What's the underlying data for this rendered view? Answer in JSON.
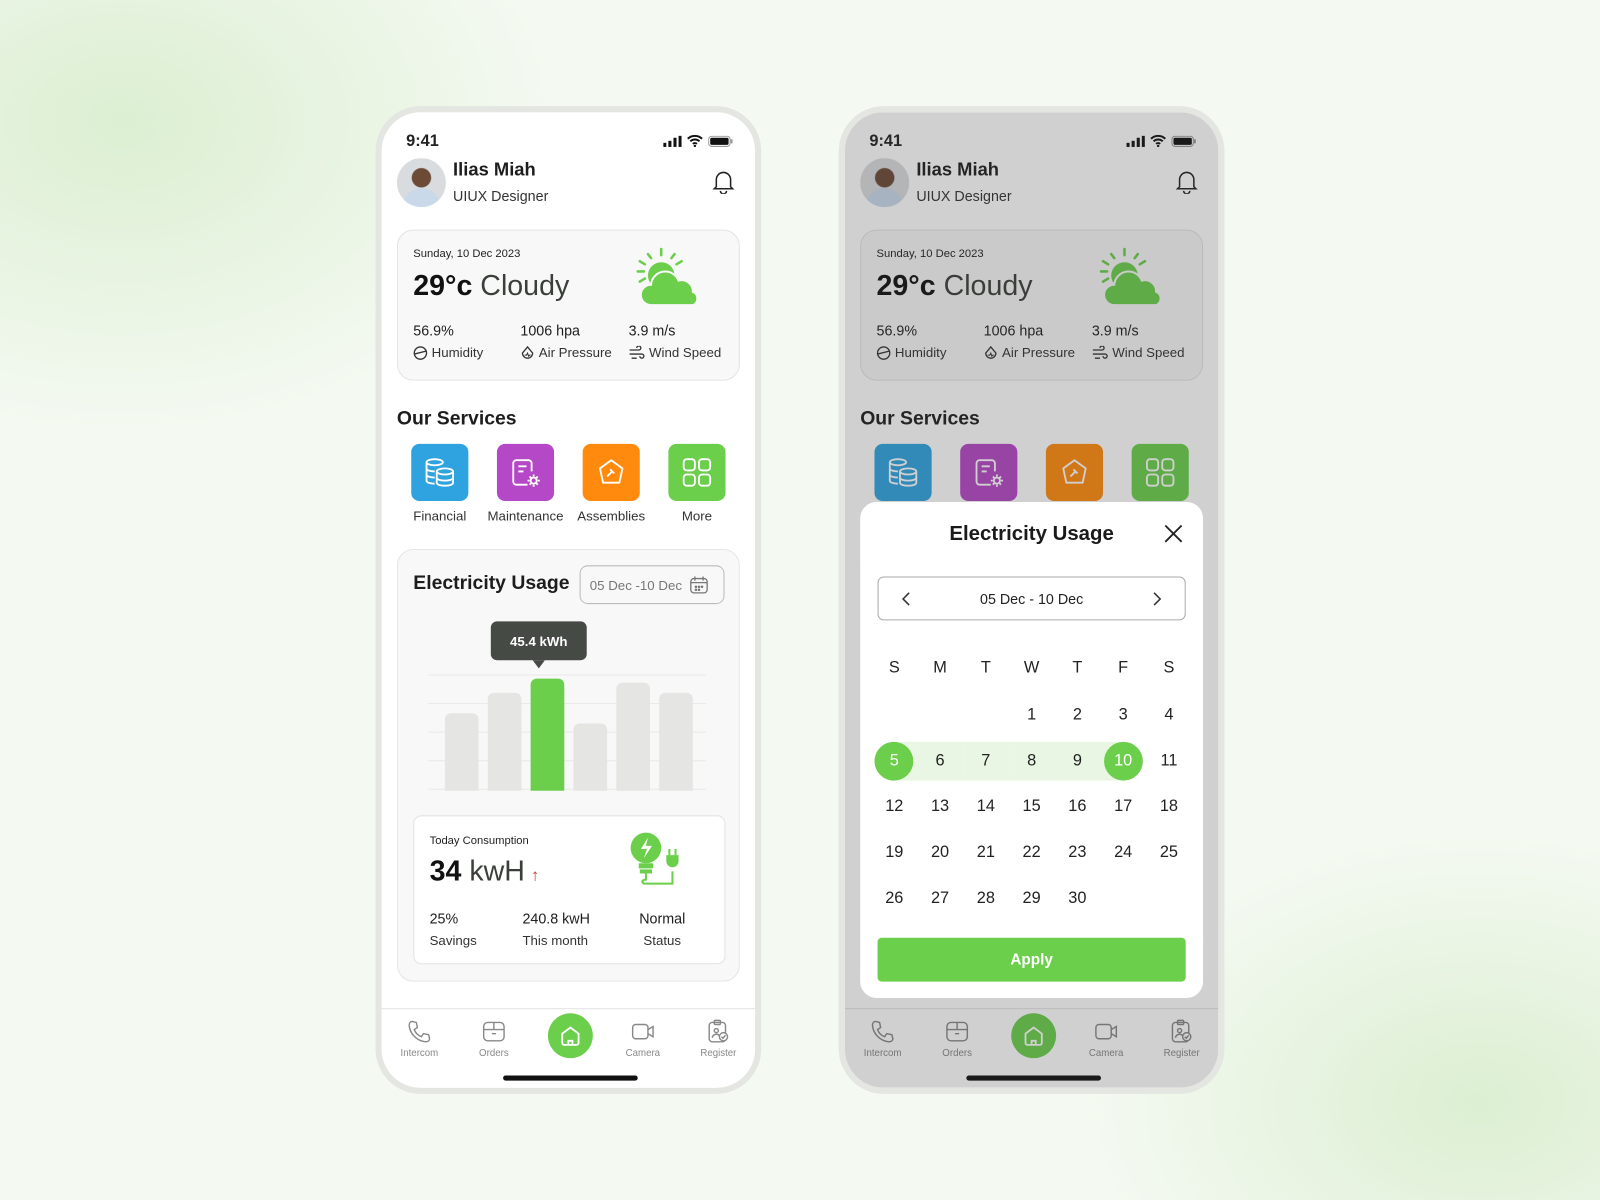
{
  "status": {
    "time": "9:41"
  },
  "user": {
    "name": "Ilias Miah",
    "role": "UIUX Designer"
  },
  "weather": {
    "date": "Sunday, 10 Dec 2023",
    "temp": "29°c",
    "condition": "Cloudy",
    "stats": [
      {
        "value": "56.9%",
        "label": "Humidity",
        "icon": "humidity-icon"
      },
      {
        "value": "1006 hpa",
        "label": "Air Pressure",
        "icon": "air-pressure-icon"
      },
      {
        "value": "3.9 m/s",
        "label": "Wind Speed",
        "icon": "wind-icon"
      }
    ]
  },
  "services": {
    "title": "Our Services",
    "items": [
      {
        "label": "Financial",
        "color": "#2fa3e0"
      },
      {
        "label": "Maintenance",
        "color": "#b548c6"
      },
      {
        "label": "Assemblies",
        "color": "#ff8a0d"
      },
      {
        "label": "More",
        "color": "#6bcf4b"
      }
    ]
  },
  "electricity": {
    "title": "Electricity Usage",
    "range": "05 Dec -10 Dec",
    "tooltip": "45.4 kWh",
    "bars": [
      31.4,
      39.6,
      45.4,
      27.2,
      43.7,
      39.6
    ],
    "highlight_index": 2,
    "accent": "#6bcf4b",
    "consumption": {
      "title": "Today Consumption",
      "value": "34",
      "unit": "kwH",
      "trend": "↑",
      "stats": [
        {
          "value": "25%",
          "label": "Savings"
        },
        {
          "value": "240.8 kwH",
          "label": "This month"
        },
        {
          "value": "Normal",
          "label": "Status"
        }
      ]
    }
  },
  "nav": [
    {
      "label": "Intercom"
    },
    {
      "label": "Orders"
    },
    {
      "label": "Home"
    },
    {
      "label": "Camera"
    },
    {
      "label": "Register"
    }
  ],
  "modal": {
    "title": "Electricity Usage",
    "range": "05 Dec - 10 Dec",
    "apply": "Apply",
    "weekdays": [
      "S",
      "M",
      "T",
      "W",
      "T",
      "F",
      "S"
    ],
    "weeks": [
      [
        "",
        "",
        "",
        "1",
        "2",
        "3",
        "4"
      ],
      [
        "5",
        "6",
        "7",
        "8",
        "9",
        "10",
        "11"
      ],
      [
        "12",
        "13",
        "14",
        "15",
        "16",
        "17",
        "18"
      ],
      [
        "19",
        "20",
        "21",
        "22",
        "23",
        "24",
        "25"
      ],
      [
        "26",
        "27",
        "28",
        "29",
        "30",
        "",
        ""
      ]
    ],
    "range_start": "5",
    "range_end": "10"
  }
}
